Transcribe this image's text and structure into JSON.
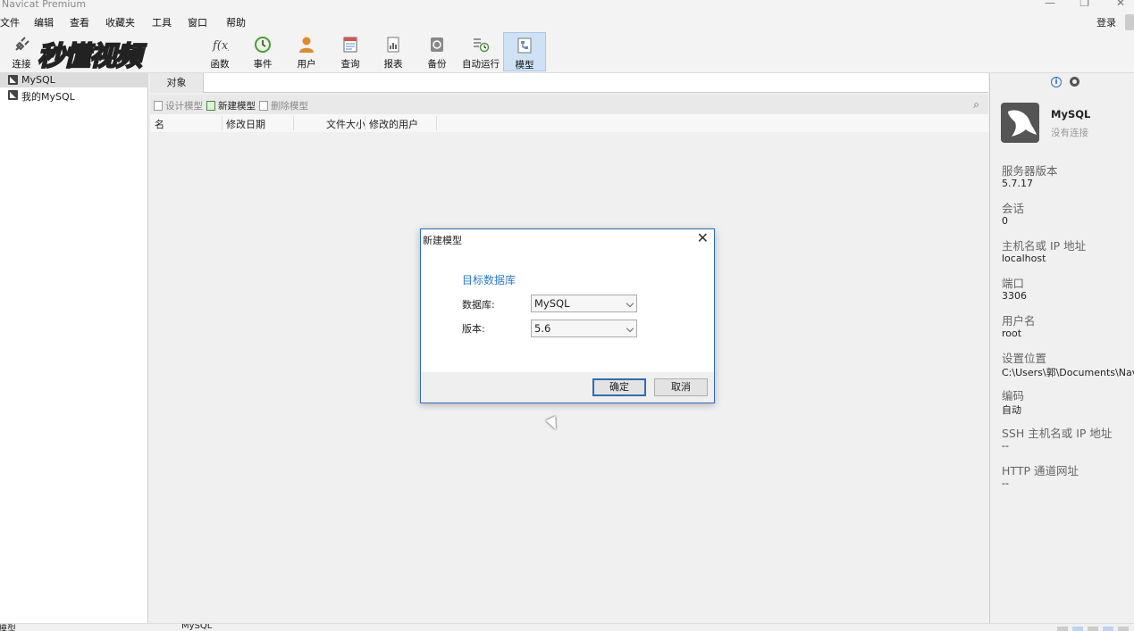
{
  "window": {
    "title": "Navicat Premium",
    "controls": [
      "—",
      "❐",
      "✕"
    ]
  },
  "menu": [
    "文件",
    "编辑",
    "查看",
    "收藏夹",
    "工具",
    "窗口",
    "帮助"
  ],
  "login_label": "登录",
  "watermark": "秒懂视频",
  "toolbar": [
    {
      "label": "连接",
      "icon": "plug-icon"
    },
    {
      "label": "函数",
      "icon": "function-icon"
    },
    {
      "label": "事件",
      "icon": "clock-icon"
    },
    {
      "label": "用户",
      "icon": "user-icon"
    },
    {
      "label": "查询",
      "icon": "query-icon"
    },
    {
      "label": "报表",
      "icon": "report-icon"
    },
    {
      "label": "备份",
      "icon": "backup-icon"
    },
    {
      "label": "自动运行",
      "icon": "autorun-icon"
    },
    {
      "label": "模型",
      "icon": "model-icon",
      "active": true
    }
  ],
  "sidebar": {
    "items": [
      {
        "label": "MySQL",
        "selected": true
      },
      {
        "label": "我的MySQL",
        "selected": false
      }
    ]
  },
  "main": {
    "tab": "对象",
    "actions": {
      "design": "设计模型",
      "new": "新建模型",
      "delete": "删除模型"
    },
    "columns": [
      "名",
      "修改日期",
      "文件大小",
      "修改的用户"
    ]
  },
  "right_panel": {
    "name": "MySQL",
    "status": "没有连接",
    "fields": [
      {
        "label": "服务器版本",
        "value": "5.7.17"
      },
      {
        "label": "会话",
        "value": "0"
      },
      {
        "label": "主机名或 IP 地址",
        "value": "localhost"
      },
      {
        "label": "端口",
        "value": "3306"
      },
      {
        "label": "用户名",
        "value": "root"
      },
      {
        "label": "设置位置",
        "value": "C:\\Users\\郭\\Documents\\Navicat"
      },
      {
        "label": "编码",
        "value": "自动"
      },
      {
        "label": "SSH 主机名或 IP 地址",
        "value": "--"
      },
      {
        "label": "HTTP 通道网址",
        "value": "--"
      }
    ]
  },
  "statusbar": {
    "left": "模型",
    "middle": "MySQL"
  },
  "dialog": {
    "title": "新建模型",
    "section": "目标数据库",
    "database_label": "数据库:",
    "database_value": "MySQL",
    "version_label": "版本:",
    "version_value": "5.6",
    "ok": "确定",
    "cancel": "取消"
  }
}
